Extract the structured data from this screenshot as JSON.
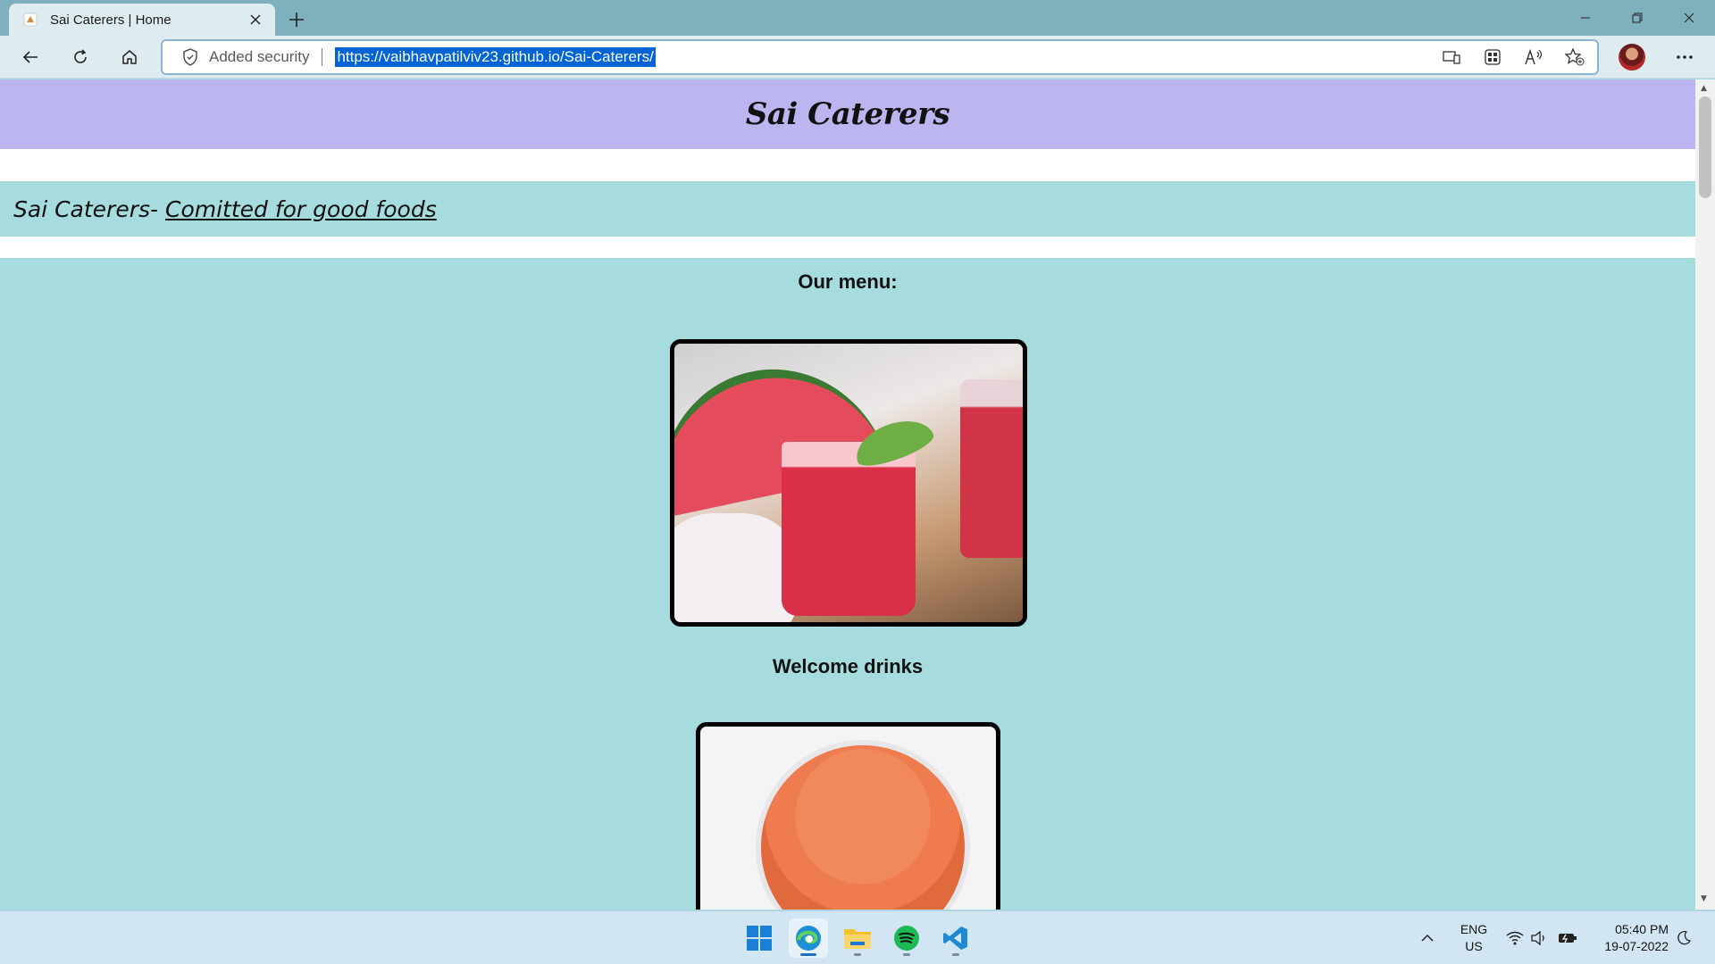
{
  "browser": {
    "tab_title": "Sai Caterers | Home",
    "security_label": "Added security",
    "url": "https://vaibhavpatilviv23.github.io/Sai-Caterers/"
  },
  "site": {
    "title": "Sai Caterers",
    "tagline_prefix": "Sai Caterers- ",
    "tagline_link": "Comitted for good foods",
    "menu_heading": "Our menu:",
    "items": [
      {
        "caption": "Welcome drinks"
      }
    ]
  },
  "taskbar": {
    "apps": [
      "windows-start",
      "edge",
      "file-explorer",
      "spotify",
      "vscode"
    ],
    "lang_line1": "ENG",
    "lang_line2": "US",
    "time": "05:40 PM",
    "date": "19-07-2022"
  },
  "colors": {
    "header_bg": "#bbb5f0",
    "page_bg": "#a7dcdf",
    "url_highlight": "#0064d6"
  }
}
